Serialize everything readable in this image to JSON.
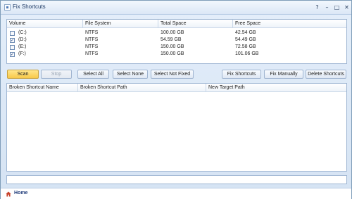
{
  "window": {
    "title": "Fix Shortcuts"
  },
  "titlebar_buttons": {
    "help": "?",
    "minimize": "–",
    "maximize": "□",
    "close": "✕"
  },
  "volumes": {
    "columns": [
      "Volume",
      "File System",
      "Total Space",
      "Free Space"
    ],
    "rows": [
      {
        "checked": false,
        "volume": "(C:)",
        "fs": "NTFS",
        "total": "100.00 GB",
        "free": "42.54 GB"
      },
      {
        "checked": true,
        "volume": "(D:)",
        "fs": "NTFS",
        "total": "54.59 GB",
        "free": "54.49 GB"
      },
      {
        "checked": false,
        "volume": "(E:)",
        "fs": "NTFS",
        "total": "150.00 GB",
        "free": "72.58 GB"
      },
      {
        "checked": true,
        "volume": "(F:)",
        "fs": "NTFS",
        "total": "150.00 GB",
        "free": "101.06 GB"
      }
    ]
  },
  "toolbar": {
    "scan": "Scan",
    "stop": "Stop",
    "select_all": "Select All",
    "select_none": "Select None",
    "select_not_fixed": "Select Not Fixed",
    "fix_shortcuts": "Fix Shortcuts",
    "fix_manually": "Fix Manually",
    "delete_shortcuts": "Delete Shortcuts"
  },
  "results": {
    "columns": [
      "Broken Shortcut Name",
      "Broken Shortcut Path",
      "New Target Path"
    ]
  },
  "status": {
    "text": ""
  },
  "bottom": {
    "home_label": "Home"
  }
}
